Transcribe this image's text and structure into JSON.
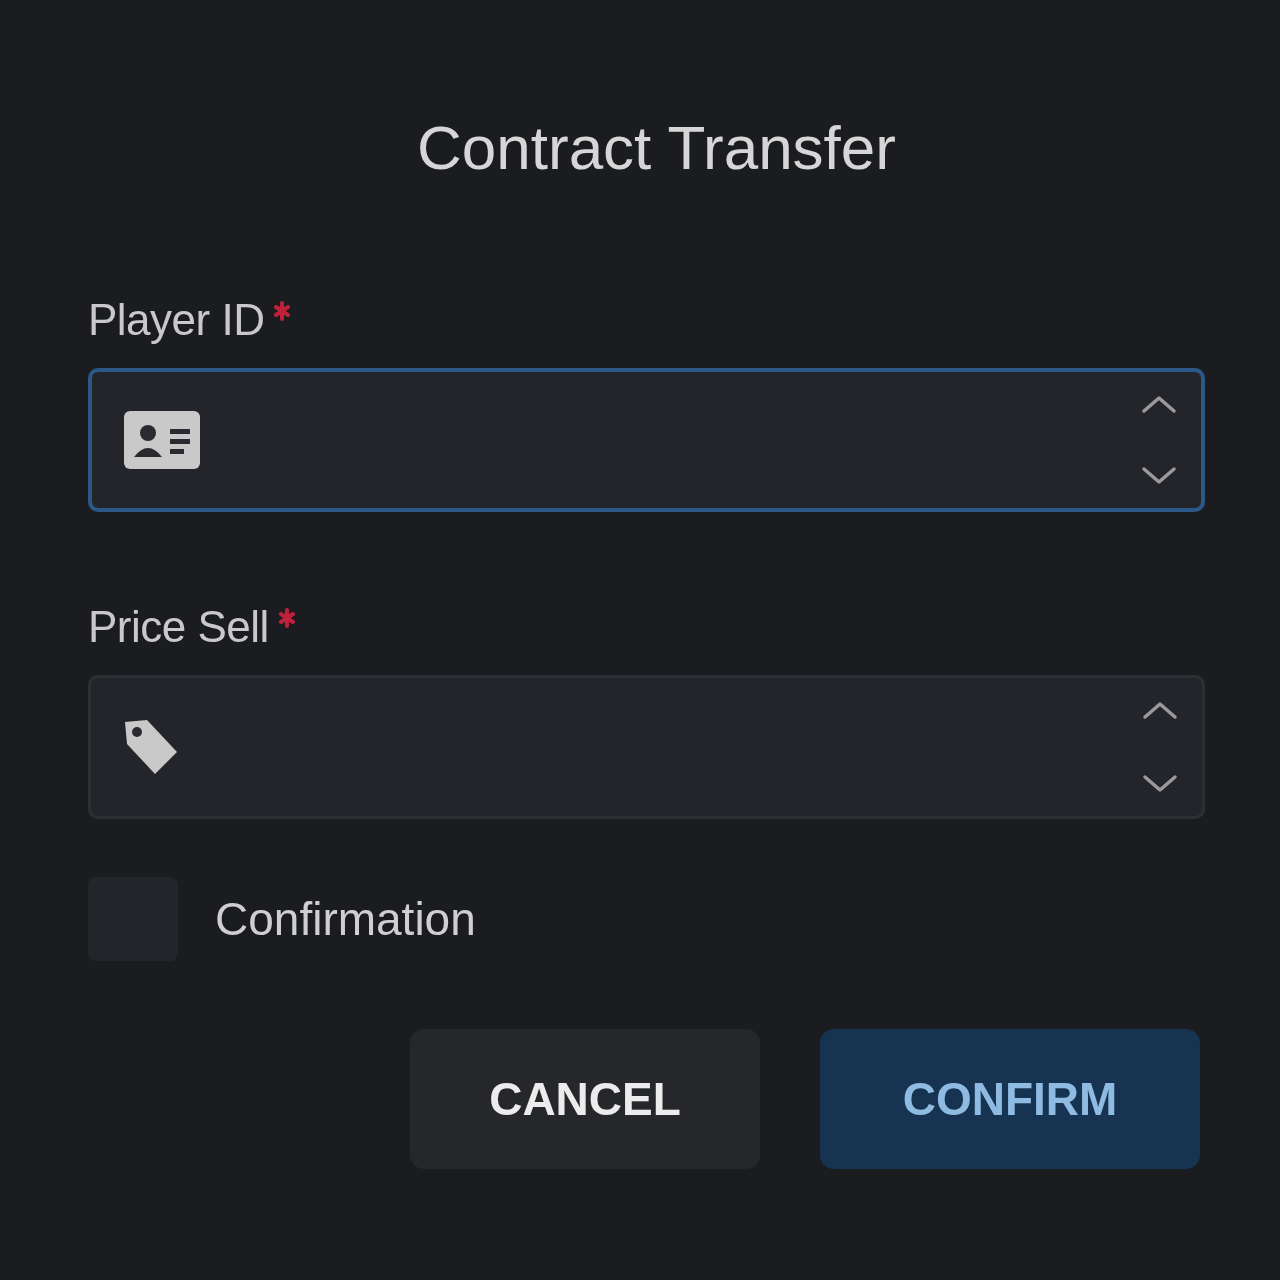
{
  "dialog": {
    "title": "Contract Transfer"
  },
  "fields": [
    {
      "label": "Player ID",
      "required": true,
      "focused": true,
      "kind": "id"
    },
    {
      "label": "Price Sell",
      "required": true,
      "focused": false,
      "kind": "price"
    }
  ],
  "confirmation": {
    "label": "Confirmation",
    "checked": false
  },
  "buttons": [
    {
      "label": "CANCEL",
      "kind": "secondary"
    },
    {
      "label": "CONFIRM",
      "kind": "primary"
    }
  ]
}
